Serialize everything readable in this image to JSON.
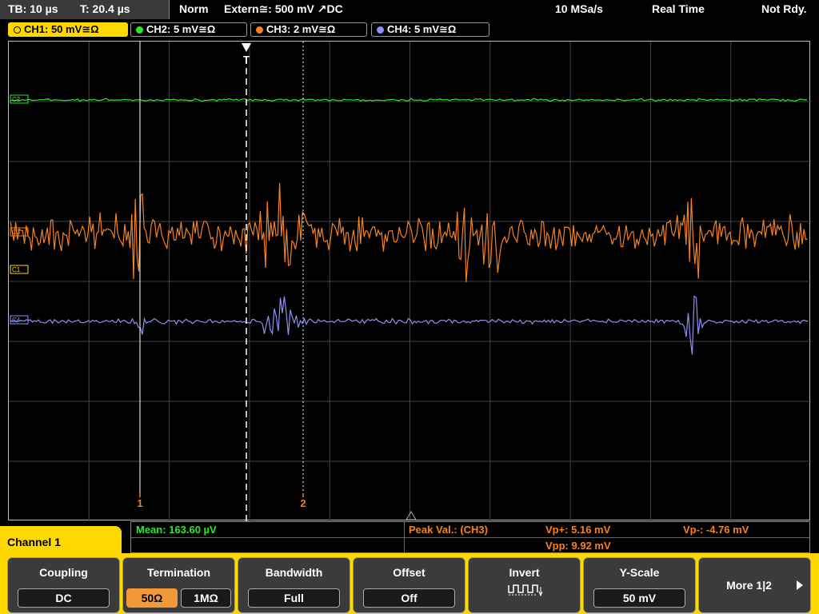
{
  "topbar": {
    "tb": "TB: 10 µs",
    "t": "T: 20.4 µs",
    "trigger_mode": "Norm",
    "trigger_source": "Extern≅: 500 mV ↗DC",
    "sample_rate": "10 MSa/s",
    "acq_mode": "Real Time",
    "status": "Not Rdy."
  },
  "channel_tabs": [
    {
      "label": "CH1: 50 mV≅Ω",
      "color": "#ffd800",
      "active": true
    },
    {
      "label": "CH2: 5 mV≅Ω",
      "color": "#2ee62e",
      "active": false
    },
    {
      "label": "CH3: 2 mV≅Ω",
      "color": "#f58220",
      "active": false
    },
    {
      "label": "CH4: 5 mV≅Ω",
      "color": "#8f8ff5",
      "active": false
    }
  ],
  "plot": {
    "trigger_marker": "T",
    "cursor1_label": "1",
    "cursor2_label": "2",
    "ch_markers": [
      "C2",
      "C3",
      "C1",
      "C4"
    ]
  },
  "measurements": {
    "mean": "Mean: 163.60 µV",
    "peak_label": "Peak Val.:  (CH3)",
    "vp_plus": "Vp+: 5.16 mV",
    "vp_minus": "Vp-: -4.76 mV",
    "vpp": "Vpp: 9.92 mV"
  },
  "channel_panel": {
    "label": "Channel 1"
  },
  "softkeys": {
    "coupling": {
      "title": "Coupling",
      "value": "DC"
    },
    "termination": {
      "title": "Termination",
      "opt1": "50Ω",
      "opt2": "1MΩ"
    },
    "bandwidth": {
      "title": "Bandwidth",
      "value": "Full"
    },
    "offset": {
      "title": "Offset",
      "value": "Off"
    },
    "invert": {
      "title": "Invert"
    },
    "yscale": {
      "title": "Y-Scale",
      "value": "50 mV"
    },
    "more": {
      "title": "More 1|2"
    }
  },
  "colors": {
    "ch1": "#ffd800",
    "ch2": "#2ee62e",
    "ch3": "#f58220",
    "ch4": "#8f8ff5",
    "accent": "#ffd800"
  }
}
